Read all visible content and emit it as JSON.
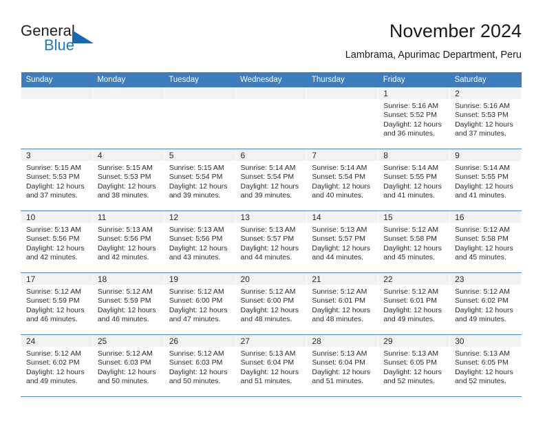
{
  "brand": {
    "line1": "General",
    "line2": "Blue",
    "accent_color": "#1668b3"
  },
  "header": {
    "title": "November 2024",
    "subtitle": "Lambrama, Apurimac Department, Peru"
  },
  "theme": {
    "header_bar_color": "#3d7cbd",
    "daynum_band_color": "#f2f2f2",
    "text_color": "#2b2b2b"
  },
  "labels": {
    "sunrise_prefix": "Sunrise:",
    "sunset_prefix": "Sunset:",
    "daylight_prefix": "Daylight:"
  },
  "weekdays": [
    "Sunday",
    "Monday",
    "Tuesday",
    "Wednesday",
    "Thursday",
    "Friday",
    "Saturday"
  ],
  "weeks": [
    [
      {
        "day": "",
        "empty": true
      },
      {
        "day": "",
        "empty": true
      },
      {
        "day": "",
        "empty": true
      },
      {
        "day": "",
        "empty": true
      },
      {
        "day": "",
        "empty": true
      },
      {
        "day": "1",
        "sunrise": "Sunrise: 5:16 AM",
        "sunset": "Sunset: 5:52 PM",
        "daylight_1": "Daylight: 12 hours",
        "daylight_2": "and 36 minutes."
      },
      {
        "day": "2",
        "sunrise": "Sunrise: 5:16 AM",
        "sunset": "Sunset: 5:53 PM",
        "daylight_1": "Daylight: 12 hours",
        "daylight_2": "and 37 minutes."
      }
    ],
    [
      {
        "day": "3",
        "sunrise": "Sunrise: 5:15 AM",
        "sunset": "Sunset: 5:53 PM",
        "daylight_1": "Daylight: 12 hours",
        "daylight_2": "and 37 minutes."
      },
      {
        "day": "4",
        "sunrise": "Sunrise: 5:15 AM",
        "sunset": "Sunset: 5:53 PM",
        "daylight_1": "Daylight: 12 hours",
        "daylight_2": "and 38 minutes."
      },
      {
        "day": "5",
        "sunrise": "Sunrise: 5:15 AM",
        "sunset": "Sunset: 5:54 PM",
        "daylight_1": "Daylight: 12 hours",
        "daylight_2": "and 39 minutes."
      },
      {
        "day": "6",
        "sunrise": "Sunrise: 5:14 AM",
        "sunset": "Sunset: 5:54 PM",
        "daylight_1": "Daylight: 12 hours",
        "daylight_2": "and 39 minutes."
      },
      {
        "day": "7",
        "sunrise": "Sunrise: 5:14 AM",
        "sunset": "Sunset: 5:54 PM",
        "daylight_1": "Daylight: 12 hours",
        "daylight_2": "and 40 minutes."
      },
      {
        "day": "8",
        "sunrise": "Sunrise: 5:14 AM",
        "sunset": "Sunset: 5:55 PM",
        "daylight_1": "Daylight: 12 hours",
        "daylight_2": "and 41 minutes."
      },
      {
        "day": "9",
        "sunrise": "Sunrise: 5:14 AM",
        "sunset": "Sunset: 5:55 PM",
        "daylight_1": "Daylight: 12 hours",
        "daylight_2": "and 41 minutes."
      }
    ],
    [
      {
        "day": "10",
        "sunrise": "Sunrise: 5:13 AM",
        "sunset": "Sunset: 5:56 PM",
        "daylight_1": "Daylight: 12 hours",
        "daylight_2": "and 42 minutes."
      },
      {
        "day": "11",
        "sunrise": "Sunrise: 5:13 AM",
        "sunset": "Sunset: 5:56 PM",
        "daylight_1": "Daylight: 12 hours",
        "daylight_2": "and 42 minutes."
      },
      {
        "day": "12",
        "sunrise": "Sunrise: 5:13 AM",
        "sunset": "Sunset: 5:56 PM",
        "daylight_1": "Daylight: 12 hours",
        "daylight_2": "and 43 minutes."
      },
      {
        "day": "13",
        "sunrise": "Sunrise: 5:13 AM",
        "sunset": "Sunset: 5:57 PM",
        "daylight_1": "Daylight: 12 hours",
        "daylight_2": "and 44 minutes."
      },
      {
        "day": "14",
        "sunrise": "Sunrise: 5:13 AM",
        "sunset": "Sunset: 5:57 PM",
        "daylight_1": "Daylight: 12 hours",
        "daylight_2": "and 44 minutes."
      },
      {
        "day": "15",
        "sunrise": "Sunrise: 5:12 AM",
        "sunset": "Sunset: 5:58 PM",
        "daylight_1": "Daylight: 12 hours",
        "daylight_2": "and 45 minutes."
      },
      {
        "day": "16",
        "sunrise": "Sunrise: 5:12 AM",
        "sunset": "Sunset: 5:58 PM",
        "daylight_1": "Daylight: 12 hours",
        "daylight_2": "and 45 minutes."
      }
    ],
    [
      {
        "day": "17",
        "sunrise": "Sunrise: 5:12 AM",
        "sunset": "Sunset: 5:59 PM",
        "daylight_1": "Daylight: 12 hours",
        "daylight_2": "and 46 minutes."
      },
      {
        "day": "18",
        "sunrise": "Sunrise: 5:12 AM",
        "sunset": "Sunset: 5:59 PM",
        "daylight_1": "Daylight: 12 hours",
        "daylight_2": "and 46 minutes."
      },
      {
        "day": "19",
        "sunrise": "Sunrise: 5:12 AM",
        "sunset": "Sunset: 6:00 PM",
        "daylight_1": "Daylight: 12 hours",
        "daylight_2": "and 47 minutes."
      },
      {
        "day": "20",
        "sunrise": "Sunrise: 5:12 AM",
        "sunset": "Sunset: 6:00 PM",
        "daylight_1": "Daylight: 12 hours",
        "daylight_2": "and 48 minutes."
      },
      {
        "day": "21",
        "sunrise": "Sunrise: 5:12 AM",
        "sunset": "Sunset: 6:01 PM",
        "daylight_1": "Daylight: 12 hours",
        "daylight_2": "and 48 minutes."
      },
      {
        "day": "22",
        "sunrise": "Sunrise: 5:12 AM",
        "sunset": "Sunset: 6:01 PM",
        "daylight_1": "Daylight: 12 hours",
        "daylight_2": "and 49 minutes."
      },
      {
        "day": "23",
        "sunrise": "Sunrise: 5:12 AM",
        "sunset": "Sunset: 6:02 PM",
        "daylight_1": "Daylight: 12 hours",
        "daylight_2": "and 49 minutes."
      }
    ],
    [
      {
        "day": "24",
        "sunrise": "Sunrise: 5:12 AM",
        "sunset": "Sunset: 6:02 PM",
        "daylight_1": "Daylight: 12 hours",
        "daylight_2": "and 49 minutes."
      },
      {
        "day": "25",
        "sunrise": "Sunrise: 5:12 AM",
        "sunset": "Sunset: 6:03 PM",
        "daylight_1": "Daylight: 12 hours",
        "daylight_2": "and 50 minutes."
      },
      {
        "day": "26",
        "sunrise": "Sunrise: 5:12 AM",
        "sunset": "Sunset: 6:03 PM",
        "daylight_1": "Daylight: 12 hours",
        "daylight_2": "and 50 minutes."
      },
      {
        "day": "27",
        "sunrise": "Sunrise: 5:13 AM",
        "sunset": "Sunset: 6:04 PM",
        "daylight_1": "Daylight: 12 hours",
        "daylight_2": "and 51 minutes."
      },
      {
        "day": "28",
        "sunrise": "Sunrise: 5:13 AM",
        "sunset": "Sunset: 6:04 PM",
        "daylight_1": "Daylight: 12 hours",
        "daylight_2": "and 51 minutes."
      },
      {
        "day": "29",
        "sunrise": "Sunrise: 5:13 AM",
        "sunset": "Sunset: 6:05 PM",
        "daylight_1": "Daylight: 12 hours",
        "daylight_2": "and 52 minutes."
      },
      {
        "day": "30",
        "sunrise": "Sunrise: 5:13 AM",
        "sunset": "Sunset: 6:05 PM",
        "daylight_1": "Daylight: 12 hours",
        "daylight_2": "and 52 minutes."
      }
    ]
  ]
}
